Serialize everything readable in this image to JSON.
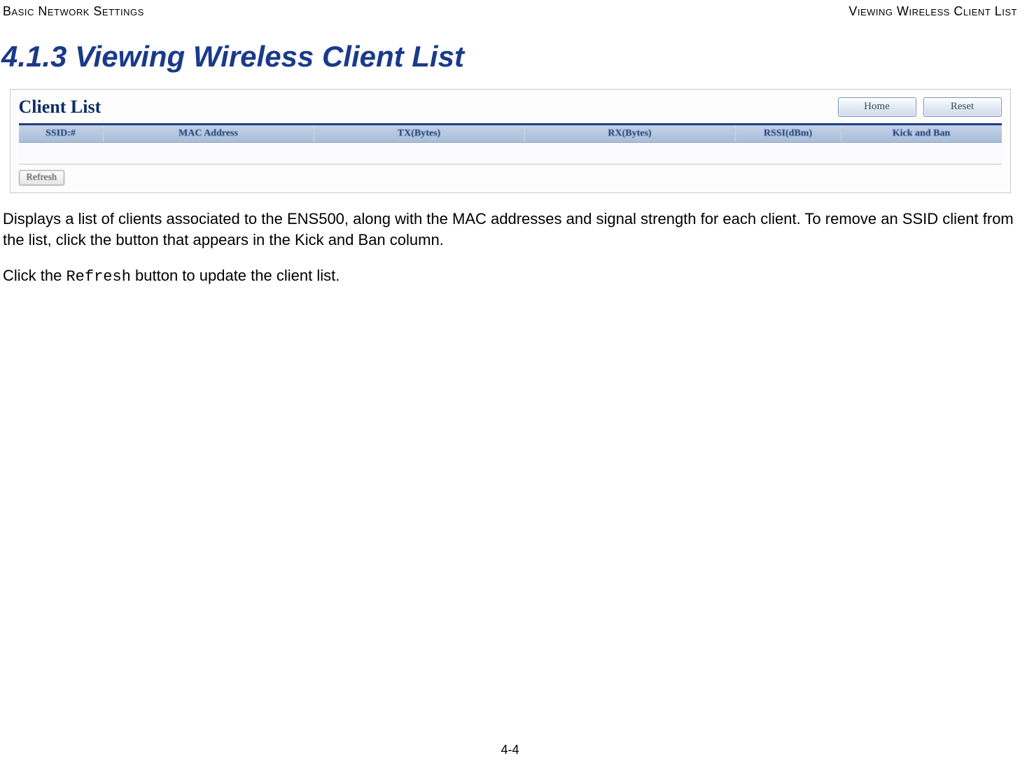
{
  "running_head": {
    "left": "Basic Network Settings",
    "right": "Viewing Wireless Client List"
  },
  "section": {
    "number_and_title": "4.1.3 Viewing Wireless Client List"
  },
  "screenshot": {
    "panel_title": "Client List",
    "buttons": {
      "home": "Home",
      "reset": "Reset"
    },
    "columns": {
      "ssid": "SSID:#",
      "mac": "MAC Address",
      "tx": "TX(Bytes)",
      "rx": "RX(Bytes)",
      "rssi": "RSSI(dBm)",
      "kick": "Kick and Ban"
    },
    "refresh": "Refresh"
  },
  "paragraph1": "Displays a list of clients associated to the ENS500, along with the MAC addresses and signal strength for each client. To remove an SSID client from the list, click the button that appears in the Kick and Ban column.",
  "paragraph2_prefix": "Click the ",
  "paragraph2_code": "Refresh",
  "paragraph2_suffix": " button to update the client list.",
  "page_number": "4-4"
}
